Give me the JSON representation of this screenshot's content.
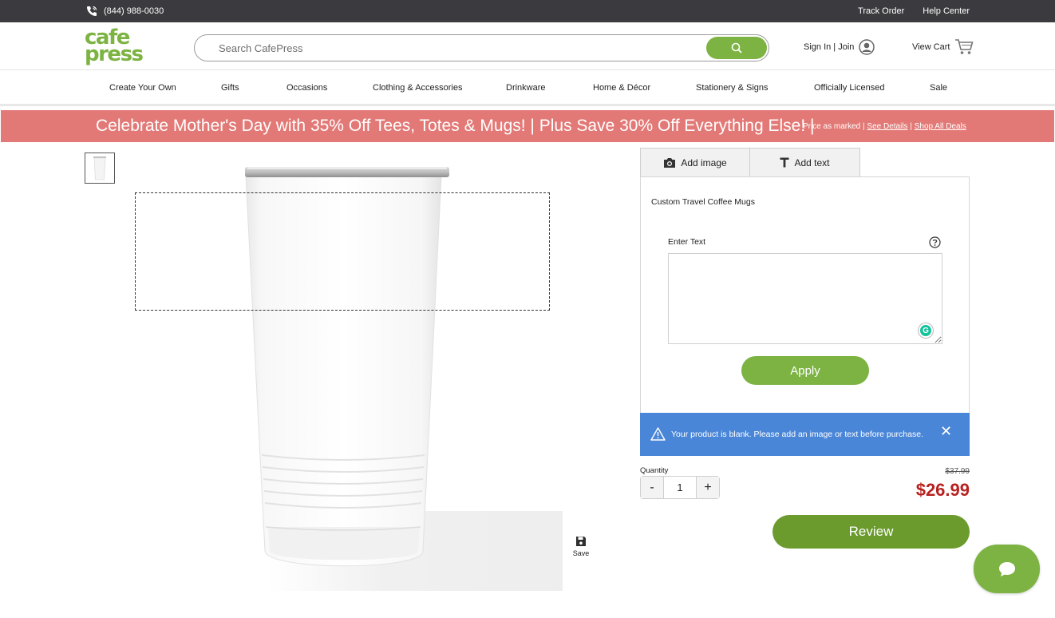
{
  "topbar": {
    "phone": "(844) 988-0030",
    "links": [
      "Track Order",
      "Help Center"
    ]
  },
  "header": {
    "logo_line1": "cafe",
    "logo_line2": "press",
    "search_placeholder": "Search CafePress",
    "signin_label": "Sign In | Join",
    "cart_label": "View Cart"
  },
  "nav": [
    "Create Your Own",
    "Gifts",
    "Occasions",
    "Clothing & Accessories",
    "Drinkware",
    "Home & Décor",
    "Stationery & Signs",
    "Officially Licensed",
    "Sale"
  ],
  "promo": {
    "headline": "Celebrate Mother's Day with 35% Off Tees, Totes & Mugs! | Plus Save 30% Off Everything Else! |",
    "note": "Price as marked |",
    "sep": "|",
    "details_link": "See Details",
    "deals_link": "Shop All Deals"
  },
  "editor": {
    "save_label": "Save",
    "tabs": [
      "Add image",
      "Add text"
    ],
    "product_title": "Custom Travel Coffee Mugs",
    "enter_text_label": "Enter Text",
    "text_value": "",
    "apply_label": "Apply",
    "grammarly": "G"
  },
  "alert": {
    "message": "Your product is blank. Please add an image or text before purchase.",
    "close": "✕"
  },
  "purchase": {
    "quantity_label": "Quantity",
    "minus": "-",
    "quantity": "1",
    "plus": "+",
    "old_price": "$37.99",
    "price": "$26.99",
    "review_label": "Review"
  },
  "colors": {
    "brand_green": "#7cb342",
    "promo": "#e27976",
    "alert_blue": "#4a86d8",
    "price_red": "#b7211f",
    "topbar": "#3b3b3f"
  }
}
